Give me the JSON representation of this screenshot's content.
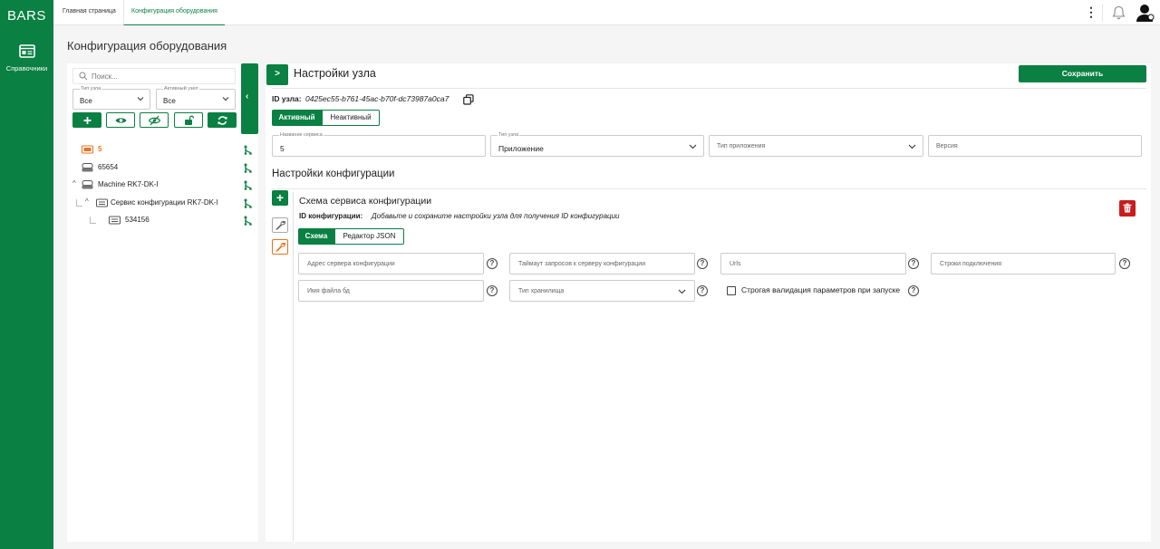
{
  "app": {
    "logo": "BARS"
  },
  "sidebar": {
    "items": [
      {
        "label": "Справочники",
        "icon": "reference-book-icon"
      }
    ]
  },
  "topbar": {
    "tabs": [
      {
        "label": "Главная страница"
      },
      {
        "label": "Конфигурация оборудования",
        "active": true
      }
    ]
  },
  "page": {
    "title": "Конфигурация оборудования"
  },
  "left": {
    "search_placeholder": "Поиск...",
    "type_select": {
      "label": "Тип узла",
      "value": "Все"
    },
    "active_select": {
      "label": "Активный узел",
      "value": "Все"
    },
    "tree": [
      {
        "label": "5",
        "depth": 0,
        "highlight": true
      },
      {
        "label": "65654",
        "depth": 0
      },
      {
        "label": "Machine RK7-DK-I",
        "depth": 0,
        "expanded": true
      },
      {
        "label": "Сервис конфигурации RK7-DK-I",
        "depth": 1,
        "expanded": true
      },
      {
        "label": "534156",
        "depth": 2
      }
    ]
  },
  "right": {
    "title": "Настройки узла",
    "save_label": "Сохранить",
    "node_id_label": "ID узла:",
    "node_id_value": "0425ec55-b761-45ac-b70f-dc73987a0ca7",
    "active_toggle": {
      "active": "Активный",
      "inactive": "Неактивный"
    },
    "fields": {
      "service_name": {
        "label": "Название сервиса",
        "value": "5"
      },
      "node_type": {
        "label": "Тип узла",
        "value": "Приложение"
      },
      "app_type": {
        "placeholder": "Тип приложения"
      },
      "version": {
        "placeholder": "Версия"
      }
    },
    "config_title": "Настройки конфигурации",
    "schema": {
      "title": "Схема сервиса конфигурации",
      "id_label": "ID конфигурации:",
      "id_value": "Добавьте и сохраните настройки узла для получения ID конфигурации",
      "tabs": {
        "schema": "Схема",
        "json": "Редактор JSON"
      },
      "fields": {
        "server_address": "Адрес сервера конфигурации",
        "timeout": "Таймаут запросов к серверу конфигурации",
        "urls": "Urls",
        "connection_strings": "Строки подключения",
        "db_file": "Имя файла бд",
        "storage_type": "Тип хранилища"
      },
      "strict_label": "Строгая валидация параметров при запуске"
    }
  },
  "colors": {
    "primary": "#0a8043",
    "danger": "#c81d1d",
    "accent": "#e8731d"
  }
}
